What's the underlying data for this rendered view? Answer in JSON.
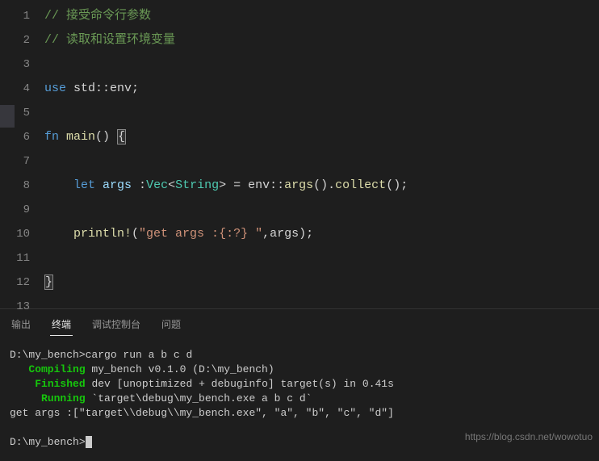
{
  "editor": {
    "lines": [
      {
        "no": "1",
        "type": "comment",
        "text": "// 接受命令行参数"
      },
      {
        "no": "2",
        "type": "comment",
        "text": "// 读取和设置环境变量"
      },
      {
        "no": "3",
        "type": "blank",
        "text": ""
      },
      {
        "no": "4",
        "type": "use",
        "kw": "use",
        "rest": " std::env;"
      },
      {
        "no": "5",
        "type": "blank",
        "text": ""
      },
      {
        "no": "6",
        "type": "fn",
        "kw": "fn",
        "name": " main",
        "paren": "()",
        "brace": "{"
      },
      {
        "no": "7",
        "type": "blank-indent",
        "text": ""
      },
      {
        "no": "8",
        "type": "let",
        "kw": "let",
        "var": " args ",
        "colon": ":",
        "t1": "Vec",
        "lt": "<",
        "t2": "String",
        "gt": ">",
        "eq": " = env::",
        "call": "args",
        "p2": "().",
        "call2": "collect",
        "end": "();"
      },
      {
        "no": "9",
        "type": "blank-indent",
        "text": ""
      },
      {
        "no": "10",
        "type": "println",
        "mac": "println!",
        "open": "(",
        "str": "\"get args :{:?} \"",
        "rest": ",args);"
      },
      {
        "no": "11",
        "type": "blank-indent",
        "text": ""
      },
      {
        "no": "12",
        "type": "close",
        "brace": "}"
      },
      {
        "no": "13",
        "type": "blank",
        "text": ""
      }
    ]
  },
  "tabs": {
    "output": "输出",
    "terminal": "终端",
    "debug": "调试控制台",
    "problems": "问题"
  },
  "terminal": {
    "prompt1": "D:\\my_bench>",
    "cmd1": "cargo run a b c d",
    "compiling_label": "Compiling",
    "compiling_text": " my_bench v0.1.0 (D:\\my_bench)",
    "finished_label": "Finished",
    "finished_text": " dev [unoptimized + debuginfo] target(s) in 0.41s",
    "running_label": "Running",
    "running_text": " `target\\debug\\my_bench.exe a b c d`",
    "output": "get args :[\"target\\\\debug\\\\my_bench.exe\", \"a\", \"b\", \"c\", \"d\"]",
    "prompt2": "D:\\my_bench>"
  },
  "watermark": "https://blog.csdn.net/wowotuo"
}
